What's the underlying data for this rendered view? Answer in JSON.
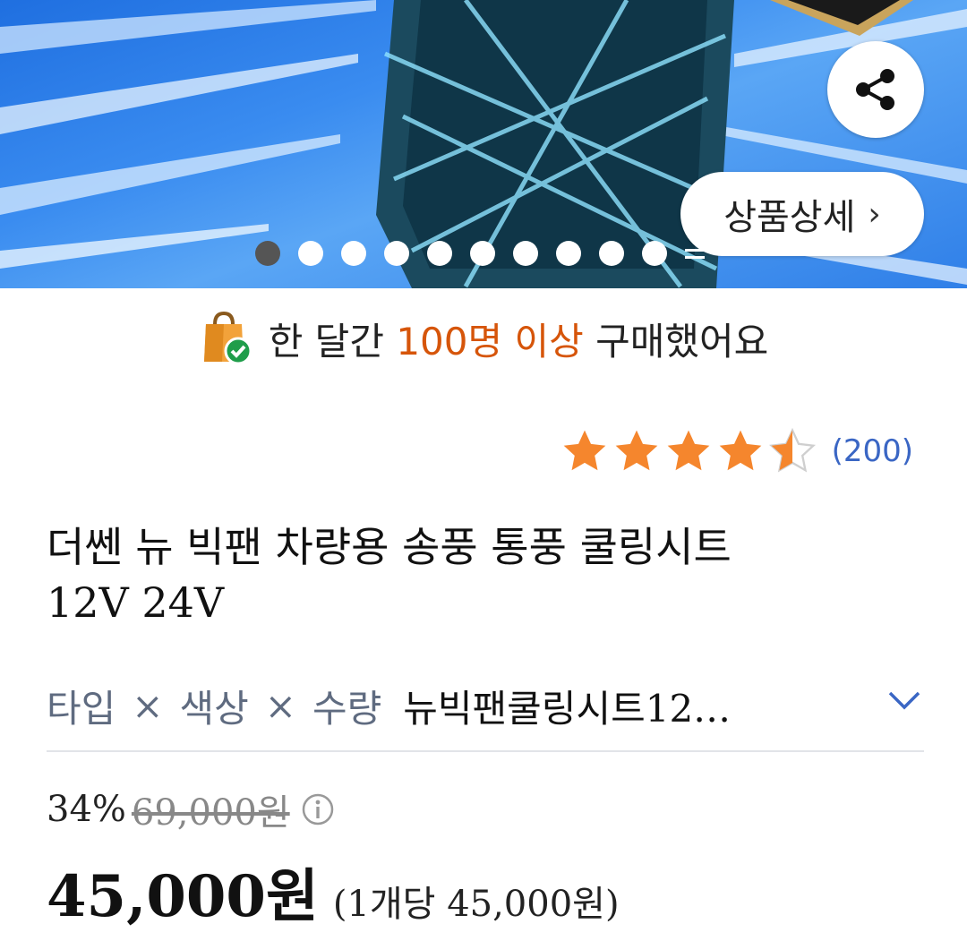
{
  "hero": {
    "share_icon": "share-icon",
    "detail_button_label": "상품상세",
    "detail_button_chevron": "›",
    "carousel": {
      "total_dots": 10,
      "active_index": 0
    }
  },
  "banner": {
    "icon": "shopping-bag-check-icon",
    "prefix": "한 달간 ",
    "highlight": "100명 이상",
    "suffix": " 구매했어요",
    "highlight_color": "#d6550a"
  },
  "rating": {
    "stars": 4.5,
    "max": 5,
    "count_text": "(200)",
    "star_color": "#f5862d"
  },
  "product": {
    "title_line1": "더쎈 뉴 빅팬 차량용 송풍 통풍 쿨링시트",
    "title_line2": "12V 24V"
  },
  "options": {
    "opt1": "타입",
    "opt2": "색상",
    "opt3": "수량",
    "separator": "×",
    "selected_value": "뉴빅팬쿨링시트12…",
    "dropdown_icon": "chevron-down-icon"
  },
  "price": {
    "discount": "34%",
    "original": "69,000원",
    "info_icon": "info-icon",
    "current": "45,000원",
    "unit_price": "(1개당 45,000원)"
  }
}
